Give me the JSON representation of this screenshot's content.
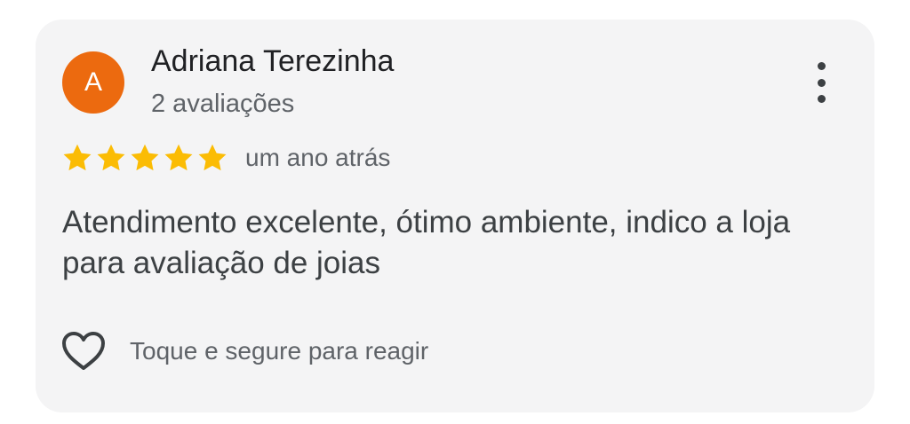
{
  "review": {
    "author": {
      "initial": "A",
      "name": "Adriana Terezinha",
      "review_count": "2 avaliações",
      "avatar_color": "#ec6a0f"
    },
    "menu_icon": "more-vert-icon",
    "rating": {
      "value": 5,
      "max": 5,
      "star_color": "#fbbc04"
    },
    "time": "um ano atrás",
    "text": "Atendimento excelente, ótimo ambiente, indico a loja para avaliação de joias",
    "reaction": {
      "icon": "heart-outline-icon",
      "label": "Toque e segure para reagir"
    }
  }
}
